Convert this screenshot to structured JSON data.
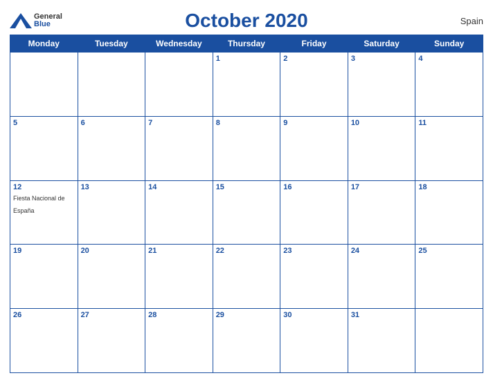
{
  "header": {
    "title": "October 2020",
    "country": "Spain",
    "logo": {
      "general": "General",
      "blue": "Blue"
    }
  },
  "days_of_week": [
    "Monday",
    "Tuesday",
    "Wednesday",
    "Thursday",
    "Friday",
    "Saturday",
    "Sunday"
  ],
  "weeks": [
    [
      {
        "day": "",
        "holiday": ""
      },
      {
        "day": "",
        "holiday": ""
      },
      {
        "day": "",
        "holiday": ""
      },
      {
        "day": "1",
        "holiday": ""
      },
      {
        "day": "2",
        "holiday": ""
      },
      {
        "day": "3",
        "holiday": ""
      },
      {
        "day": "4",
        "holiday": ""
      }
    ],
    [
      {
        "day": "5",
        "holiday": ""
      },
      {
        "day": "6",
        "holiday": ""
      },
      {
        "day": "7",
        "holiday": ""
      },
      {
        "day": "8",
        "holiday": ""
      },
      {
        "day": "9",
        "holiday": ""
      },
      {
        "day": "10",
        "holiday": ""
      },
      {
        "day": "11",
        "holiday": ""
      }
    ],
    [
      {
        "day": "12",
        "holiday": "Fiesta Nacional de España"
      },
      {
        "day": "13",
        "holiday": ""
      },
      {
        "day": "14",
        "holiday": ""
      },
      {
        "day": "15",
        "holiday": ""
      },
      {
        "day": "16",
        "holiday": ""
      },
      {
        "day": "17",
        "holiday": ""
      },
      {
        "day": "18",
        "holiday": ""
      }
    ],
    [
      {
        "day": "19",
        "holiday": ""
      },
      {
        "day": "20",
        "holiday": ""
      },
      {
        "day": "21",
        "holiday": ""
      },
      {
        "day": "22",
        "holiday": ""
      },
      {
        "day": "23",
        "holiday": ""
      },
      {
        "day": "24",
        "holiday": ""
      },
      {
        "day": "25",
        "holiday": ""
      }
    ],
    [
      {
        "day": "26",
        "holiday": ""
      },
      {
        "day": "27",
        "holiday": ""
      },
      {
        "day": "28",
        "holiday": ""
      },
      {
        "day": "29",
        "holiday": ""
      },
      {
        "day": "30",
        "holiday": ""
      },
      {
        "day": "31",
        "holiday": ""
      },
      {
        "day": "",
        "holiday": ""
      }
    ]
  ]
}
